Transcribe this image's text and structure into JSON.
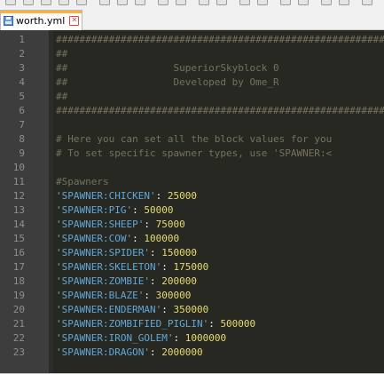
{
  "tab": {
    "label": "worth.yml",
    "close_glyph": "✕"
  },
  "lines": [
    {
      "n": "1",
      "type": "comment",
      "text": "############################################################"
    },
    {
      "n": "2",
      "type": "comment",
      "text": "##"
    },
    {
      "n": "3",
      "type": "comment",
      "text": "##                  SuperiorSkyblock 0"
    },
    {
      "n": "4",
      "type": "comment",
      "text": "##                  Developed by Ome_R"
    },
    {
      "n": "5",
      "type": "comment",
      "text": "##"
    },
    {
      "n": "6",
      "type": "comment",
      "text": "############################################################"
    },
    {
      "n": "7",
      "type": "blank",
      "text": ""
    },
    {
      "n": "8",
      "type": "comment",
      "text": "# Here you can set all the block values for you"
    },
    {
      "n": "9",
      "type": "comment",
      "text": "# To set specific spawner types, use 'SPAWNER:<"
    },
    {
      "n": "10",
      "type": "blank",
      "text": ""
    },
    {
      "n": "11",
      "type": "comment",
      "text": "#Spawners"
    },
    {
      "n": "12",
      "type": "entry",
      "key": "'SPAWNER:CHICKEN'",
      "sep": ": ",
      "value": "25000"
    },
    {
      "n": "13",
      "type": "entry",
      "key": "'SPAWNER:PIG'",
      "sep": ": ",
      "value": "50000"
    },
    {
      "n": "14",
      "type": "entry",
      "key": "'SPAWNER:SHEEP'",
      "sep": ": ",
      "value": "75000"
    },
    {
      "n": "15",
      "type": "entry",
      "key": "'SPAWNER:COW'",
      "sep": ": ",
      "value": "100000"
    },
    {
      "n": "16",
      "type": "entry",
      "key": "'SPAWNER:SPIDER'",
      "sep": ": ",
      "value": "150000"
    },
    {
      "n": "17",
      "type": "entry",
      "key": "'SPAWNER:SKELETON'",
      "sep": ": ",
      "value": "175000"
    },
    {
      "n": "18",
      "type": "entry",
      "key": "'SPAWNER:ZOMBIE'",
      "sep": ": ",
      "value": "200000"
    },
    {
      "n": "19",
      "type": "entry",
      "key": "'SPAWNER:BLAZE'",
      "sep": ": ",
      "value": "300000"
    },
    {
      "n": "20",
      "type": "entry",
      "key": "'SPAWNER:ENDERMAN'",
      "sep": ": ",
      "value": "350000"
    },
    {
      "n": "21",
      "type": "entry",
      "key": "'SPAWNER:ZOMBIFIED_PIGLIN'",
      "sep": ": ",
      "value": "500000"
    },
    {
      "n": "22",
      "type": "entry",
      "key": "'SPAWNER:IRON_GOLEM'",
      "sep": ": ",
      "value": "1000000"
    },
    {
      "n": "23",
      "type": "entry",
      "key": "'SPAWNER:DRAGON'",
      "sep": ": ",
      "value": "2000000"
    }
  ],
  "colors": {
    "editor_bg": "#272822",
    "gutter_bg": "#3d3d3d",
    "comment": "#75715e",
    "key": "#62a7d6",
    "number": "#e6db74",
    "tab_accent": "#ffb03b"
  }
}
